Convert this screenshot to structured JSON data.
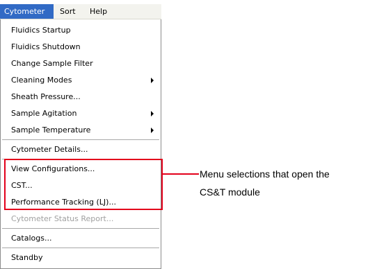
{
  "menubar": {
    "items": [
      {
        "label": "Cytometer",
        "active": true
      },
      {
        "label": "Sort",
        "active": false
      },
      {
        "label": "Help",
        "active": false
      }
    ]
  },
  "menu": {
    "items": [
      {
        "label": "Fluidics Startup",
        "enabled": true,
        "submenu": false
      },
      {
        "label": "Fluidics Shutdown",
        "enabled": true,
        "submenu": false
      },
      {
        "label": "Change Sample Filter",
        "enabled": true,
        "submenu": false
      },
      {
        "label": "Cleaning Modes",
        "enabled": true,
        "submenu": true
      },
      {
        "label": "Sheath Pressure...",
        "enabled": true,
        "submenu": false
      },
      {
        "label": "Sample Agitation",
        "enabled": true,
        "submenu": true
      },
      {
        "label": "Sample Temperature",
        "enabled": true,
        "submenu": true
      },
      {
        "label": "Cytometer Details...",
        "enabled": true,
        "submenu": false
      },
      {
        "label": "View Configurations...",
        "enabled": true,
        "submenu": false
      },
      {
        "label": "CST...",
        "enabled": true,
        "submenu": false
      },
      {
        "label": "Performance Tracking (LJ)...",
        "enabled": true,
        "submenu": false
      },
      {
        "label": "Cytometer Status Report...",
        "enabled": false,
        "submenu": false
      },
      {
        "label": "Catalogs...",
        "enabled": true,
        "submenu": false
      },
      {
        "label": "Standby",
        "enabled": true,
        "submenu": false
      }
    ]
  },
  "callout": {
    "line1": "Menu selections that open the",
    "line2": "CS&T module"
  },
  "colors": {
    "menubar_active_bg": "#316ac5",
    "highlight_border": "#e3001b",
    "disabled_text": "#a0a0a0"
  }
}
